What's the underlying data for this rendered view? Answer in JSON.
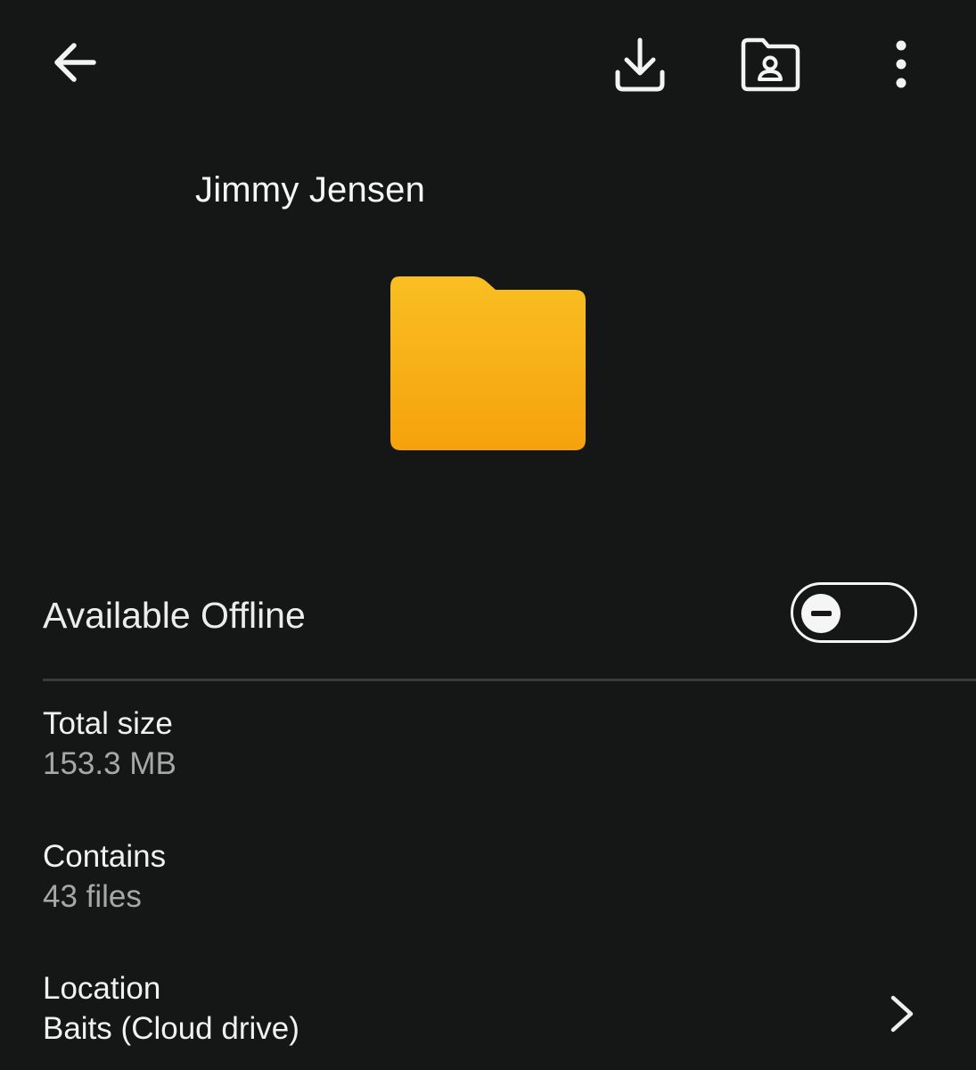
{
  "toolbar": {
    "back_icon": "arrow-left-icon",
    "download_icon": "download-icon",
    "share_folder_icon": "shared-folder-icon",
    "more_icon": "more-vertical-icon"
  },
  "folder": {
    "name": "Jimmy Jensen",
    "preview_icon": "folder-icon",
    "preview_color": "#f7b51f"
  },
  "offline": {
    "label": "Available Offline",
    "enabled": false,
    "knob_icon": "minus-icon"
  },
  "details": {
    "total_size_label": "Total size",
    "total_size_value": "153.3 MB",
    "contains_label": "Contains",
    "contains_value": "43 files",
    "location_label": "Location",
    "location_value": "Baits (Cloud drive)",
    "location_icon": "chevron-right-icon"
  },
  "colors": {
    "background": "#151616",
    "text": "#f4f4f4",
    "secondary_text": "#a7a7a7",
    "divider": "#393a3a"
  }
}
